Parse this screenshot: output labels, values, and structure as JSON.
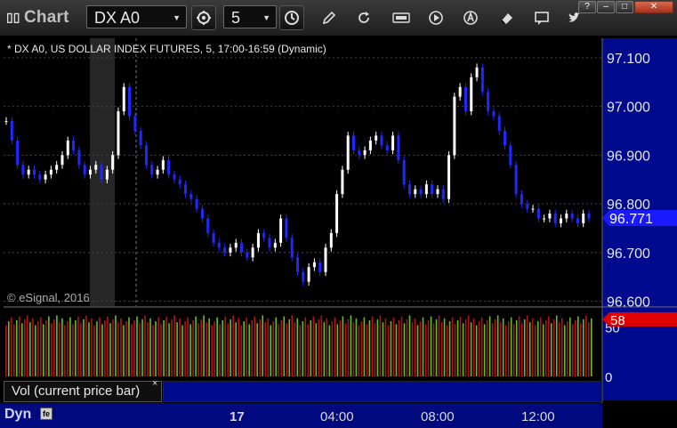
{
  "window": {
    "title": "Chart",
    "symbol": "DX A0",
    "interval": "5"
  },
  "toolbar": {
    "icons": [
      "settings-icon",
      "clock-icon",
      "pencil-icon",
      "refresh-icon",
      "get-icon",
      "play-icon",
      "alert-icon",
      "eraser-icon",
      "comment-icon",
      "twitter-icon"
    ]
  },
  "chart": {
    "legend": "* DX A0, US DOLLAR INDEX FUTURES, 5, 17:00-16:59 (Dynamic)",
    "copyright": "© eSignal, 2016",
    "last_price_label": "96.771",
    "volume_label": "Vol (current price bar)",
    "volume_close": "×",
    "volume_last_label": "58",
    "dynamic_label": "Dyn",
    "dynamic_icon": "fe",
    "colors": {
      "up": "#ffffff",
      "down": "#1e28ff",
      "price_tag": "#1a1aff",
      "volume_tag": "#e00000",
      "vol_up": "#5fbf2a",
      "vol_down": "#b01414",
      "panel_bg": "#000a8c"
    }
  },
  "chart_data": {
    "type": "candlestick",
    "title": "DX A0, US DOLLAR INDEX FUTURES, 5, 17:00-16:59 (Dynamic)",
    "y_ticks": [
      "97.100",
      "97.000",
      "96.900",
      "96.800",
      "96.700",
      "96.600"
    ],
    "y_tick_values": [
      97.1,
      97.0,
      96.9,
      96.8,
      96.7,
      96.6
    ],
    "ylim": [
      96.59,
      97.14
    ],
    "x_ticks": [
      "17",
      "04:00",
      "08:00",
      "12:00"
    ],
    "vol_ticks": [
      "50",
      "0"
    ],
    "vol_tick_values": [
      50,
      0
    ],
    "vol_ylim": [
      0,
      66
    ],
    "last_price": 96.771,
    "last_volume": 58,
    "series": [
      {
        "values": [
          96.97,
          96.93,
          96.88,
          96.86,
          96.87,
          96.86,
          96.85,
          96.86,
          96.87,
          96.88,
          96.9,
          96.93,
          96.91,
          96.88,
          96.86,
          96.87,
          96.88,
          96.85,
          96.87,
          96.9,
          96.99,
          97.04,
          96.98,
          96.95,
          96.92,
          96.88,
          96.86,
          96.87,
          96.89,
          96.86,
          96.85,
          96.84,
          96.82,
          96.81,
          96.79,
          96.77,
          96.74,
          96.72,
          96.71,
          96.7,
          96.71,
          96.72,
          96.7,
          96.69,
          96.71,
          96.74,
          96.73,
          96.71,
          96.72,
          96.77,
          96.73,
          96.69,
          96.66,
          96.64,
          96.67,
          96.68,
          96.66,
          96.71,
          96.74,
          96.82,
          96.87,
          96.94,
          96.91,
          96.9,
          96.91,
          96.93,
          96.94,
          96.92,
          96.91,
          96.94,
          96.89,
          96.84,
          96.82,
          96.83,
          96.82,
          96.84,
          96.82,
          96.83,
          96.81,
          96.9,
          97.02,
          97.04,
          96.99,
          97.06,
          97.08,
          97.03,
          96.99,
          96.98,
          96.95,
          96.92,
          96.88,
          96.82,
          96.8,
          96.79,
          96.79,
          96.77,
          96.77,
          96.78,
          96.76,
          96.77,
          96.78,
          96.77,
          96.76,
          96.78,
          96.77
        ]
      }
    ]
  }
}
